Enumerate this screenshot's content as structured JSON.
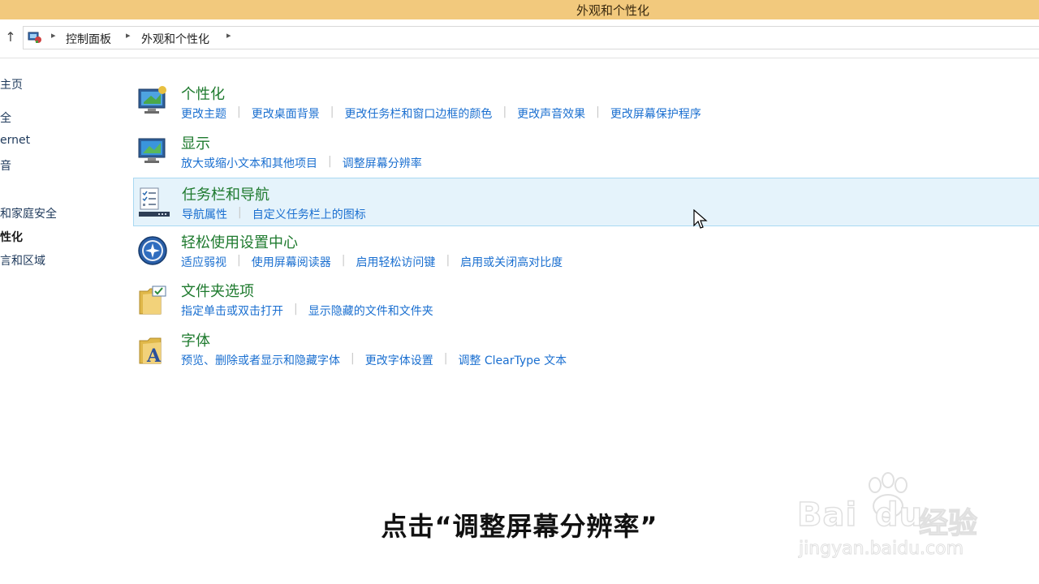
{
  "window": {
    "title": "外观和个性化"
  },
  "breadcrumb": {
    "items": [
      "控制面板",
      "外观和个性化"
    ]
  },
  "leftnav": {
    "items": [
      {
        "label": "主页"
      },
      {
        "label": "全"
      },
      {
        "label": "ernet"
      },
      {
        "label": "音"
      },
      {
        "label": "和家庭安全"
      },
      {
        "label": "性化"
      },
      {
        "label": "言和区域"
      }
    ]
  },
  "categories": [
    {
      "heading": "个性化",
      "icon": "personalization-icon",
      "links": [
        "更改主题",
        "更改桌面背景",
        "更改任务栏和窗口边框的颜色",
        "更改声音效果",
        "更改屏幕保护程序"
      ]
    },
    {
      "heading": "显示",
      "icon": "display-icon",
      "links": [
        "放大或缩小文本和其他项目",
        "调整屏幕分辨率"
      ]
    },
    {
      "heading": "任务栏和导航",
      "icon": "taskbar-icon",
      "links": [
        "导航属性",
        "自定义任务栏上的图标"
      ]
    },
    {
      "heading": "轻松使用设置中心",
      "icon": "ease-of-access-icon",
      "links": [
        "适应弱视",
        "使用屏幕阅读器",
        "启用轻松访问键",
        "启用或关闭高对比度"
      ]
    },
    {
      "heading": "文件夹选项",
      "icon": "folder-options-icon",
      "links": [
        "指定单击或双击打开",
        "显示隐藏的文件和文件夹"
      ]
    },
    {
      "heading": "字体",
      "icon": "fonts-icon",
      "links": [
        "预览、删除或者显示和隐藏字体",
        "更改字体设置",
        "调整 ClearType 文本"
      ]
    }
  ],
  "subtitle": "点击“调整屏幕分辨率”",
  "watermark": {
    "brand": "Bai",
    "brand_tail": "du",
    "product": "经验",
    "url": "jingyan.baidu.com"
  },
  "colors": {
    "titlebar": "#f2c97d",
    "heading": "#1e7a2e",
    "link": "#1a6fd0",
    "hover_bg": "#e5f3fb"
  }
}
